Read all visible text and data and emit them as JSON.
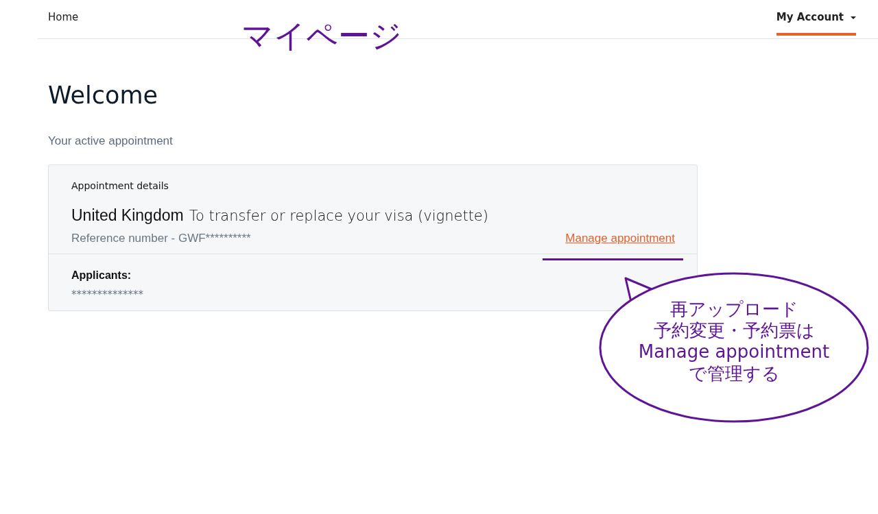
{
  "nav": {
    "items": [
      {
        "label": "Home",
        "selected": false,
        "kind": "link"
      },
      {
        "label": "My Account",
        "selected": true,
        "kind": "dropdown"
      }
    ]
  },
  "page": {
    "title": "Welcome",
    "subtitle": "Your active appointment"
  },
  "appointment": {
    "heading": "Appointment details",
    "country": "United Kingdom",
    "service": "To transfer or replace your visa (vignette)",
    "reference": "Reference number - GWF**********",
    "manage_link": "Manage appointment",
    "applicants_label": "Applicants:",
    "applicants_value": "**************"
  },
  "annotations": {
    "title": "マイページ",
    "callout_lines": [
      "再アップロード",
      "予約変更・予約票は",
      "Manage appointment",
      "で管理する"
    ]
  }
}
